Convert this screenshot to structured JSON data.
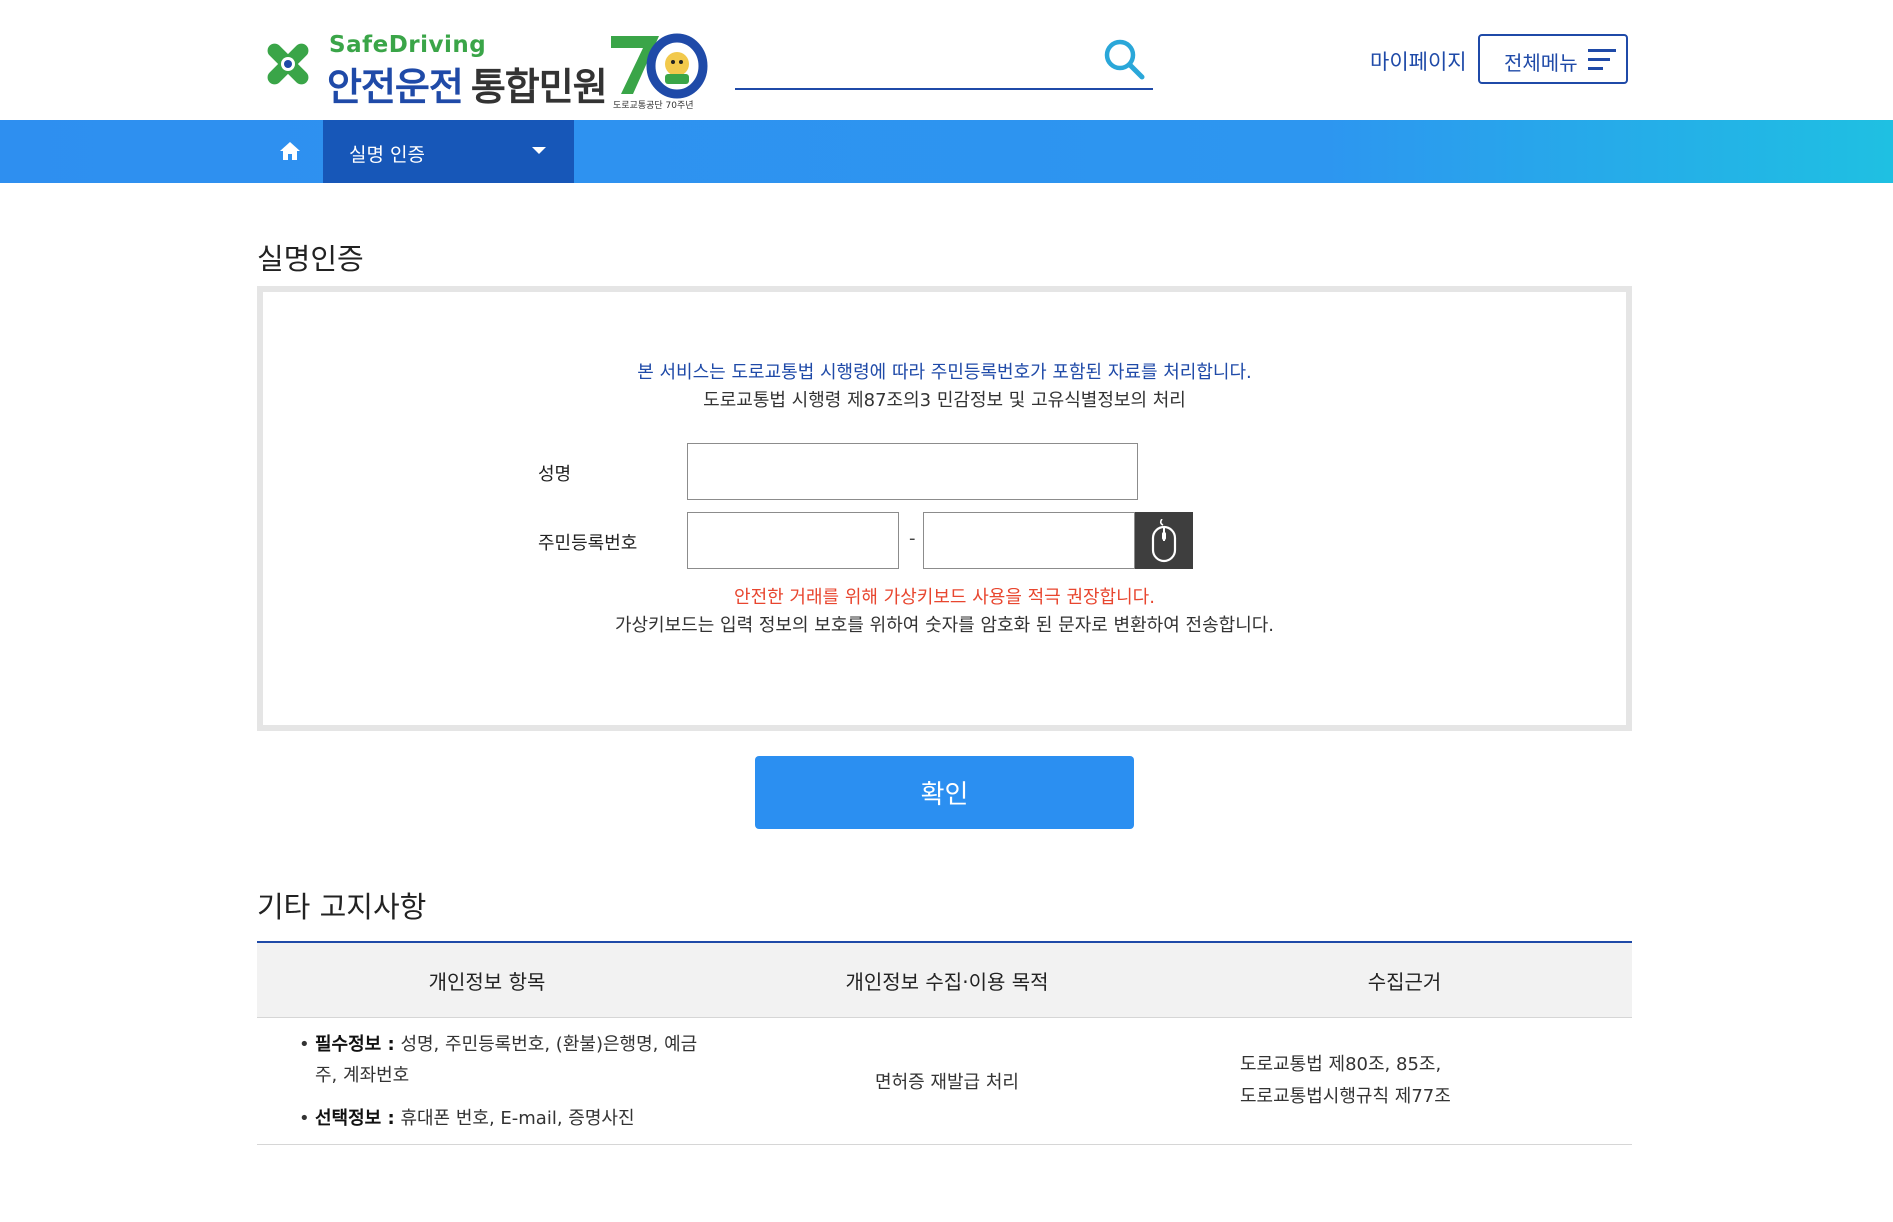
{
  "header": {
    "brand_en": "SafeDriving",
    "brand_ko": "안전운전",
    "brand_sub": "통합민원",
    "anniversary_caption": "도로교통공단 70주년",
    "search_placeholder": "",
    "mypage_label": "마이페이지",
    "allmenu_label": "전체메뉴"
  },
  "nav": {
    "current": "실명 인증"
  },
  "auth": {
    "title": "실명인증",
    "notice_primary": "본 서비스는 도로교통법 시행령에 따라 주민등록번호가 포함된 자료를 처리합니다.",
    "notice_secondary": "도로교통법 시행령 제87조의3 민감정보 및 고유식별정보의 처리",
    "name_label": "성명",
    "rrn_label": "주민등록번호",
    "rrn_separator": "-",
    "name_value": "",
    "rrn_front_value": "",
    "rrn_back_value": "",
    "warning_primary": "안전한 거래를 위해 가상키보드 사용을 적극 권장합니다.",
    "warning_secondary": "가상키보드는 입력 정보의 보호를 위하여 숫자를 암호화 된 문자로 변환하여 전송합니다.",
    "confirm_label": "확인"
  },
  "notice": {
    "title": "기타 고지사항",
    "headers": [
      "개인정보 항목",
      "개인정보 수집·이용 목적",
      "수집근거"
    ],
    "required_label": "필수정보 :",
    "required_text": " 성명, 주민등록번호, (환불)은행명, 예금주, 계좌번호",
    "optional_label": "선택정보 :",
    "optional_text": " 휴대폰 번호, E-mail, 증명사진",
    "purpose": "면허증 재발급 처리",
    "basis_line1": "도로교통법 제80조, 85조,",
    "basis_line2": "도로교통법시행규칙 제77조"
  },
  "colors": {
    "brand_blue": "#1f4aa8",
    "nav_blue": "#2e8ff0",
    "nav_selected": "#1757b8",
    "brand_green": "#3aa548",
    "warning_red": "#e8462f",
    "button_blue": "#2b8ff1"
  },
  "icons": [
    "clover-logo-icon",
    "search-icon",
    "hamburger-icon",
    "home-icon",
    "caret-down-icon",
    "mouse-icon"
  ]
}
